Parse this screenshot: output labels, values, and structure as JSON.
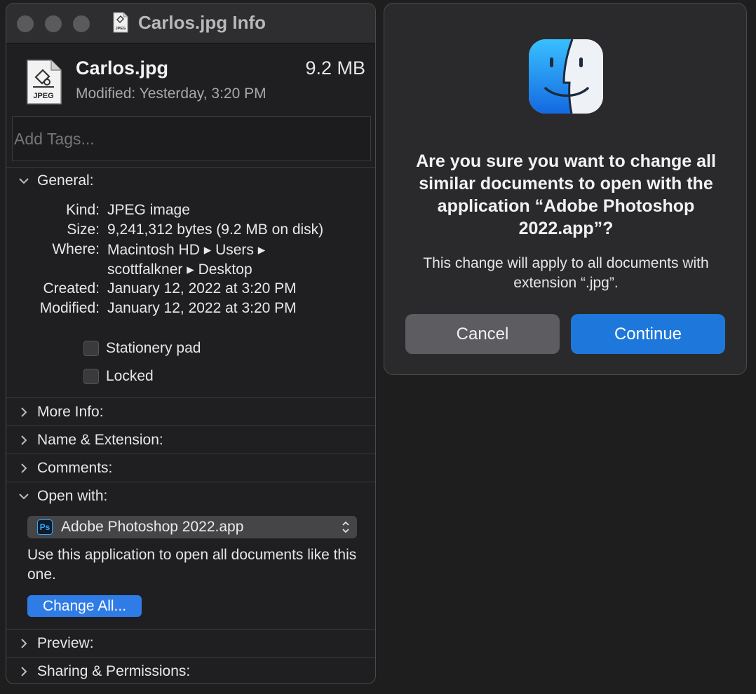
{
  "info_window": {
    "title": "Carlos.jpg Info",
    "file_name": "Carlos.jpg",
    "file_size": "9.2 MB",
    "modified_line": "Modified: Yesterday, 3:20 PM",
    "file_icon_label": "JPEG",
    "title_icon_label": "JPEG",
    "tags_placeholder": "Add Tags...",
    "general": {
      "label": "General:",
      "kind_key": "Kind:",
      "kind_value": "JPEG image",
      "size_key": "Size:",
      "size_value": "9,241,312 bytes (9.2 MB on disk)",
      "where_key": "Where:",
      "where_value_1": "Macintosh HD ▸ Users ▸",
      "where_value_2": "scottfalkner ▸ Desktop",
      "created_key": "Created:",
      "created_value": "January 12, 2022 at 3:20 PM",
      "modified_key": "Modified:",
      "modified_value": "January 12, 2022 at 3:20 PM",
      "stationery_label": "Stationery pad",
      "locked_label": "Locked"
    },
    "sections": {
      "more_info": "More Info:",
      "name_extension": "Name & Extension:",
      "comments": "Comments:",
      "open_with": "Open with:",
      "preview": "Preview:",
      "sharing": "Sharing & Permissions:"
    },
    "open_with": {
      "app_icon": "Ps",
      "app_name": "Adobe Photoshop 2022.app",
      "description": "Use this application to open all documents like this one.",
      "change_all_label": "Change All..."
    }
  },
  "alert": {
    "title": "Are you sure you want to change all similar documents to open with the application “Adobe Photoshop 2022.app”?",
    "message": "This change will apply to all documents with extension “.jpg”.",
    "cancel_label": "Cancel",
    "continue_label": "Continue"
  },
  "colors": {
    "accent": "#1e78db",
    "window_bg": "#1f1f22",
    "alert_bg": "#2a2a2d"
  }
}
